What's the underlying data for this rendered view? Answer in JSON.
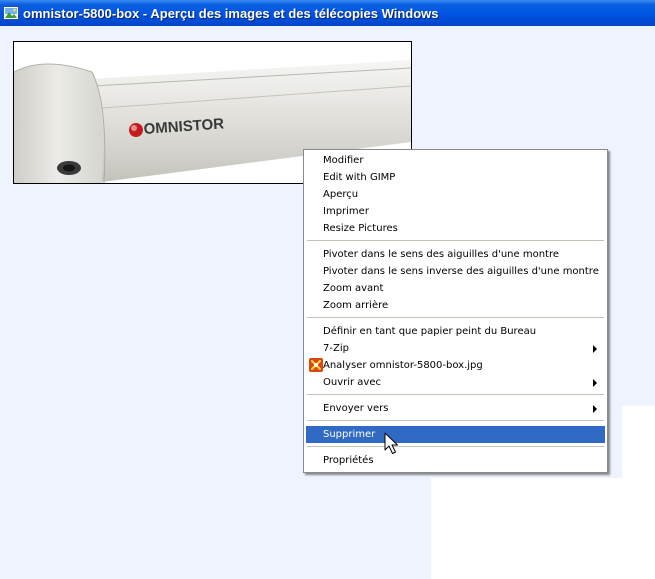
{
  "window": {
    "title": "omnistor-5800-box - Aperçu des images et des télécopies Windows"
  },
  "image": {
    "brand_text": "OMNISTOR"
  },
  "context_menu": {
    "group1": [
      "Modifier",
      "Edit with GIMP",
      "Aperçu",
      "Imprimer",
      "Resize Pictures"
    ],
    "group2": [
      "Pivoter dans le sens des aiguilles d'une montre",
      "Pivoter dans le sens inverse des aiguilles d'une montre",
      "Zoom avant",
      "Zoom arrière"
    ],
    "group3": [
      {
        "label": "Définir en tant que papier peint du Bureau",
        "submenu": false
      },
      {
        "label": "7-Zip",
        "submenu": true
      },
      {
        "label": "Analyser omnistor-5800-box.jpg",
        "submenu": false,
        "icon": "antivirus-scan-icon"
      },
      {
        "label": "Ouvrir avec",
        "submenu": true
      }
    ],
    "send_to": "Envoyer vers",
    "delete": "Supprimer",
    "properties": "Propriétés",
    "highlighted_item": "Supprimer"
  },
  "colors": {
    "titlebar": "#0054e3",
    "highlight": "#316ac5",
    "viewer_background": "#eef3fe"
  }
}
